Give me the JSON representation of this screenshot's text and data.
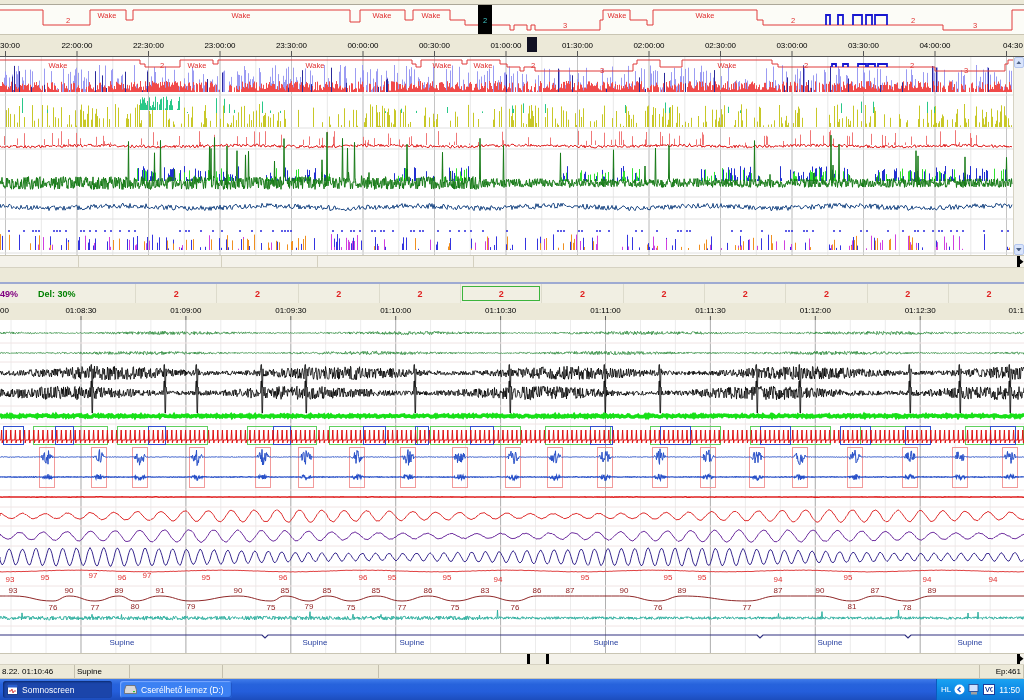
{
  "overview": {
    "hypnogram_labels": [
      "2",
      "Wake",
      "Wake",
      "Wake",
      "Wake",
      "3",
      "Wake",
      "Wake",
      "2",
      "2",
      "3"
    ],
    "cursor_label": "2",
    "time_labels": [
      "30:00",
      "22:00:00",
      "22:30:00",
      "23:00:00",
      "23:30:00",
      "00:00:00",
      "00:30:00",
      "01:00:00",
      "01:30:00",
      "02:00:00",
      "02:30:00",
      "03:00:00",
      "03:30:00",
      "04:00:00",
      "04:30"
    ],
    "trace_labels": [
      "Wake",
      "2",
      "Wake",
      "Wake",
      "Wake",
      "Wake",
      "2",
      "3",
      "Wake",
      "2",
      "2",
      "3"
    ]
  },
  "scoring": {
    "percentages": [
      {
        "text": "49%",
        "color": "#800080"
      },
      {
        "text": "Del: 30%",
        "color": "#008000"
      }
    ],
    "epochs": [
      {
        "stage": "2",
        "selected": false
      },
      {
        "stage": "2",
        "selected": false
      },
      {
        "stage": "2",
        "selected": false
      },
      {
        "stage": "2",
        "selected": false
      },
      {
        "stage": "2",
        "selected": true
      },
      {
        "stage": "2",
        "selected": false
      },
      {
        "stage": "2",
        "selected": false
      },
      {
        "stage": "2",
        "selected": false
      },
      {
        "stage": "2",
        "selected": false
      },
      {
        "stage": "2",
        "selected": false
      },
      {
        "stage": "2",
        "selected": false
      }
    ],
    "time_labels": [
      "00",
      "01:08:30",
      "01:09:00",
      "01:09:30",
      "01:10:00",
      "01:10:30",
      "01:11:00",
      "01:11:30",
      "01:12:00",
      "01:12:30",
      "01:1"
    ]
  },
  "signals": {
    "spo2_values": [
      "93",
      "95",
      "97",
      "96",
      "97",
      "95",
      "96",
      "96",
      "95",
      "95",
      "94",
      "95",
      "95",
      "95",
      "94",
      "95",
      "94",
      "94"
    ],
    "pulse_values": [
      "93",
      "76",
      "90",
      "77",
      "89",
      "80",
      "91",
      "79",
      "90",
      "75",
      "85",
      "79",
      "85",
      "75",
      "85",
      "77",
      "86",
      "75",
      "83",
      "76",
      "86",
      "87",
      "90",
      "76",
      "89",
      "77",
      "87",
      "90",
      "81",
      "87",
      "78",
      "89"
    ],
    "position_labels": [
      "Supine",
      "Supine",
      "Supine",
      "Supine",
      "Supine",
      "Supine"
    ]
  },
  "status_bar": {
    "datetime": "8.22. 01:10:46",
    "position": "Supine",
    "epoch": "Ep:461"
  },
  "taskbar": {
    "buttons": [
      {
        "label": "Somnoscreen",
        "selected": true
      },
      {
        "label": "Cserélhető lemez (D:)",
        "selected": false
      }
    ],
    "language": "HL",
    "clock": "11:50"
  }
}
